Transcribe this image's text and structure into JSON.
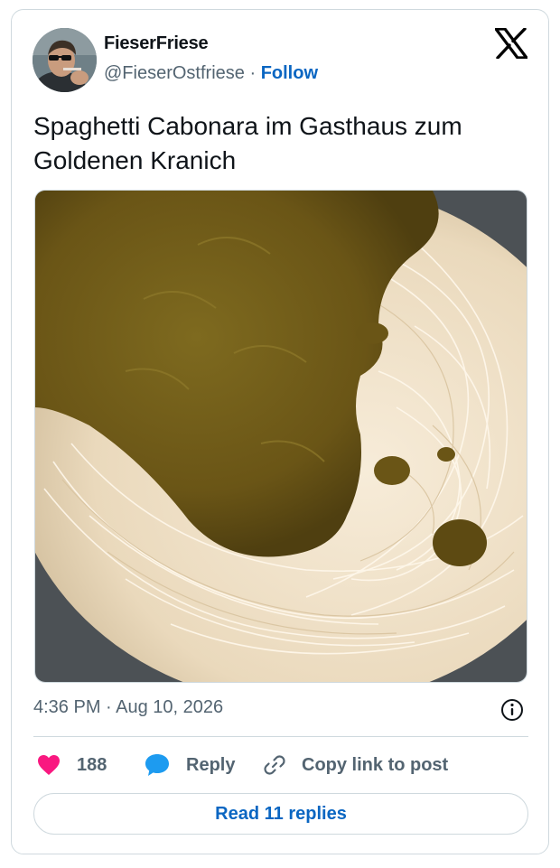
{
  "author": {
    "name": "FieserFriese",
    "handle": "@FieserOstfriese",
    "separator": "·",
    "follow_label": "Follow"
  },
  "tweet": {
    "text": "Spaghetti Cabonara im Gasthaus zum Goldenen Kranich",
    "timestamp": "4:36 PM · Aug 10, 2026"
  },
  "actions": {
    "like_count": "188",
    "reply_label": "Reply",
    "copy_label": "Copy link to post"
  },
  "read_replies_label": "Read 11 replies",
  "colors": {
    "accent_blue": "#0a66c2",
    "like_pink": "#f91880",
    "muted_text": "#536471",
    "border": "#cfd9de"
  },
  "icons": [
    "x-logo-icon",
    "info-icon",
    "heart-icon",
    "reply-bubble-icon",
    "link-icon"
  ]
}
